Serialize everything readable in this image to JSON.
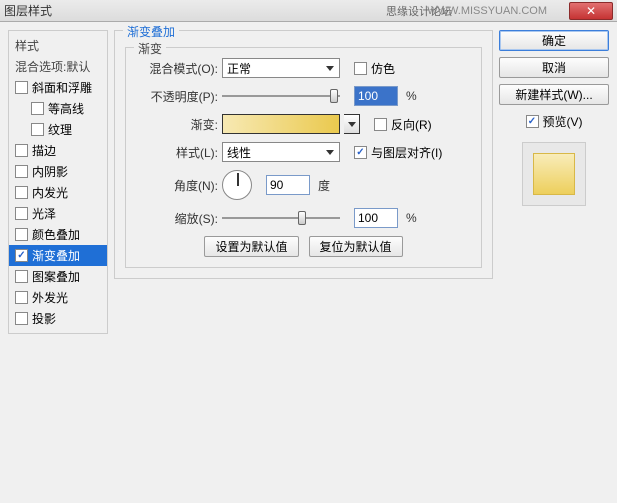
{
  "titlebar": {
    "title": "图层样式",
    "watermark_cn": "思缘设计论坛",
    "watermark_en": "WWW.MISSYUAN.COM",
    "close": "✕"
  },
  "left": {
    "styles_label": "样式",
    "blend_default": "混合选项:默认",
    "items": [
      {
        "label": "斜面和浮雕",
        "checked": false,
        "indent": 0
      },
      {
        "label": "等高线",
        "checked": false,
        "indent": 1
      },
      {
        "label": "纹理",
        "checked": false,
        "indent": 1
      },
      {
        "label": "描边",
        "checked": false,
        "indent": 0
      },
      {
        "label": "内阴影",
        "checked": false,
        "indent": 0
      },
      {
        "label": "内发光",
        "checked": false,
        "indent": 0
      },
      {
        "label": "光泽",
        "checked": false,
        "indent": 0
      },
      {
        "label": "颜色叠加",
        "checked": false,
        "indent": 0
      },
      {
        "label": "渐变叠加",
        "checked": true,
        "indent": 0,
        "selected": true
      },
      {
        "label": "图案叠加",
        "checked": false,
        "indent": 0
      },
      {
        "label": "外发光",
        "checked": false,
        "indent": 0
      },
      {
        "label": "投影",
        "checked": false,
        "indent": 0
      }
    ]
  },
  "center": {
    "group_title": "渐变叠加",
    "sub_title": "渐变",
    "blend_mode_label": "混合模式(O):",
    "blend_mode_value": "正常",
    "dither_label": "仿色",
    "opacity_label": "不透明度(P):",
    "opacity_value": "100",
    "pct": "%",
    "gradient_label": "渐变:",
    "reverse_label": "反向(R)",
    "style_label": "样式(L):",
    "style_value": "线性",
    "align_label": "与图层对齐(I)",
    "angle_label": "角度(N):",
    "angle_value": "90",
    "angle_unit": "度",
    "scale_label": "缩放(S):",
    "scale_value": "100",
    "set_default": "设置为默认值",
    "reset_default": "复位为默认值"
  },
  "right": {
    "ok": "确定",
    "cancel": "取消",
    "new_style": "新建样式(W)...",
    "preview_label": "预览(V)"
  }
}
